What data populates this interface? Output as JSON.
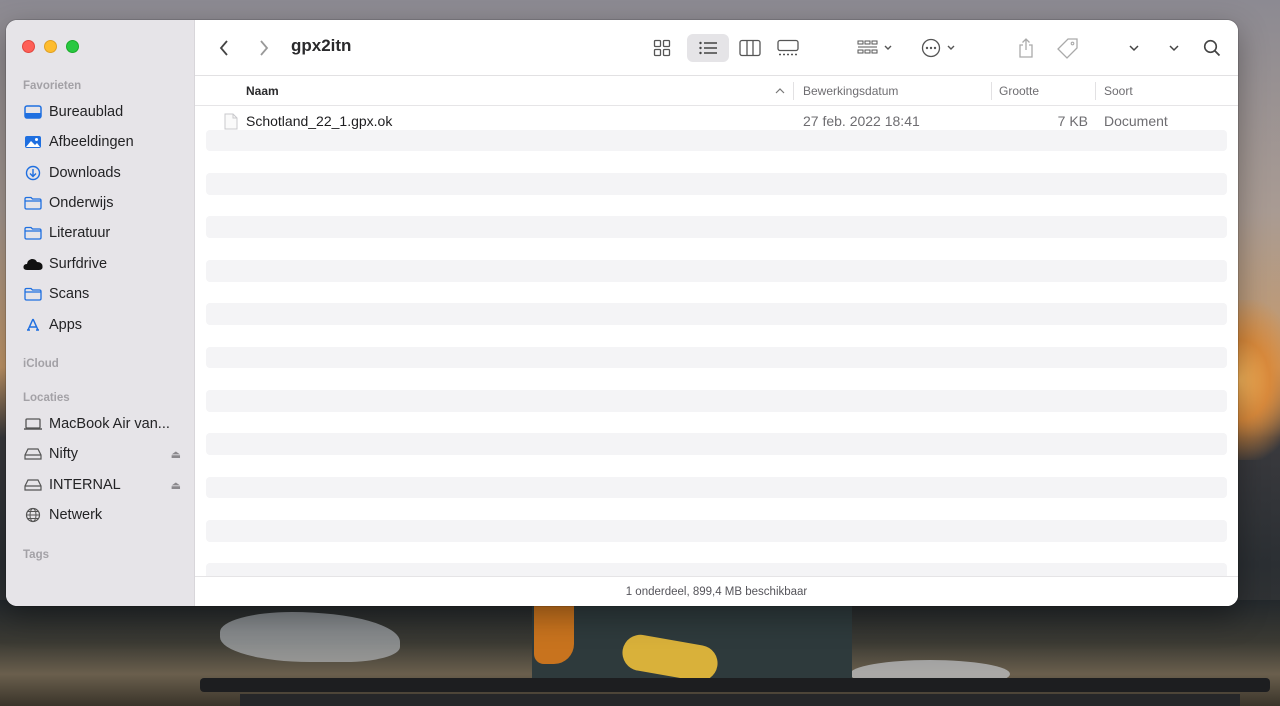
{
  "window": {
    "title": "gpx2itn"
  },
  "sidebar": {
    "favorites_header": "Favorieten",
    "favorites": [
      {
        "label": "Bureaublad",
        "icon": "desktop-icon"
      },
      {
        "label": "Afbeeldingen",
        "icon": "photos-icon"
      },
      {
        "label": "Downloads",
        "icon": "downloads-icon"
      },
      {
        "label": "Onderwijs",
        "icon": "folder-icon"
      },
      {
        "label": "Literatuur",
        "icon": "folder-icon"
      },
      {
        "label": "Surfdrive",
        "icon": "cloud-icon"
      },
      {
        "label": "Scans",
        "icon": "folder-icon"
      },
      {
        "label": "Apps",
        "icon": "apps-icon"
      }
    ],
    "icloud_header": "iCloud",
    "locations_header": "Locaties",
    "locations": [
      {
        "label": "MacBook Air van...",
        "icon": "laptop-icon"
      },
      {
        "label": "Nifty",
        "icon": "drive-icon",
        "eject": "⏏"
      },
      {
        "label": "INTERNAL",
        "icon": "drive-icon",
        "eject": "⏏"
      },
      {
        "label": "Netwerk",
        "icon": "network-icon"
      }
    ],
    "tags_header": "Tags"
  },
  "columns": {
    "name": "Naam",
    "modified": "Bewerkingsdatum",
    "size": "Grootte",
    "kind": "Soort"
  },
  "files": [
    {
      "name": "Schotland_22_1.gpx.ok",
      "modified": "27 feb. 2022 18:41",
      "size": "7 KB",
      "kind": "Document"
    }
  ],
  "status": "1 onderdeel, 899,4 MB beschikbaar",
  "colors": {
    "sidebar_bg": "#e6e4e8",
    "accent": "#1f6fe0",
    "stripe": "#f4f4f6"
  }
}
